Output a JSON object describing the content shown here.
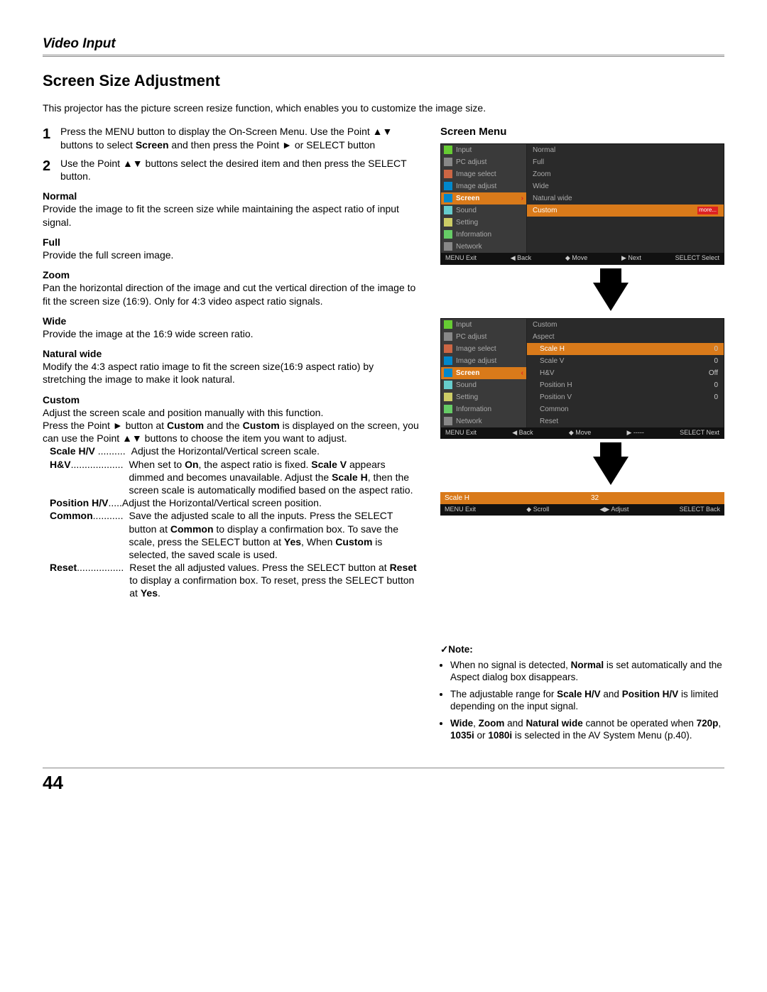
{
  "section": "Video Input",
  "title": "Screen Size Adjustment",
  "intro": "This projector has the picture screen resize function, which enables you to customize the image size.",
  "steps": {
    "s1": {
      "num": "1",
      "text_a": "Press the MENU button to display the On-Screen Menu. Use the Point ▲▼ buttons to select ",
      "bold": "Screen",
      "text_b": " and then press the Point ► or SELECT button"
    },
    "s2": {
      "num": "2",
      "text": "Use the Point ▲▼ buttons select the desired item and then press the SELECT button."
    }
  },
  "modes": {
    "normal": {
      "title": "Normal",
      "text": "Provide the image to fit the screen size while maintaining the aspect ratio of input signal."
    },
    "full": {
      "title": "Full",
      "text": "Provide the full screen image."
    },
    "zoom": {
      "title": "Zoom",
      "text": "Pan the horizontal direction of the image and cut the vertical direction of the image to fit the screen size (16:9). Only for 4:3 video aspect ratio signals."
    },
    "wide": {
      "title": "Wide",
      "text": "Provide the image at the 16:9 wide screen ratio."
    },
    "natural": {
      "title": "Natural wide",
      "text": "Modify the 4:3 aspect ratio image to fit the screen size(16:9 aspect ratio) by stretching the image to make it look natural."
    },
    "custom": {
      "title": "Custom",
      "p1": "Adjust the screen scale and position manually with this function.",
      "p2_a": "Press the Point ► button at ",
      "p2_b": "Custom",
      "p2_c": " and the ",
      "p2_d": "Custom",
      "p2_e": " is displayed on the screen, you can use the Point ▲▼ buttons to choose the item you want to adjust."
    }
  },
  "defs": {
    "scalehv": {
      "term": "Scale H/V",
      "dots": " ..........",
      "desc": "Adjust the Horizontal/Vertical screen scale."
    },
    "hv": {
      "term": "H&V",
      "dots": "...................",
      "desc_a": "When set to ",
      "on": "On",
      "desc_b": ", the aspect ratio is fixed. ",
      "sv": "Scale V",
      "desc_c": " appears dimmed and becomes unavailable. Adjust the ",
      "sh": "Scale H",
      "desc_d": ", then the screen scale is automatically modified based on the aspect ratio."
    },
    "poshv": {
      "term": "Position H/V",
      "dots": ".....",
      "desc": "Adjust the Horizontal/Vertical screen position."
    },
    "common": {
      "term": "Common",
      "dots": "...........",
      "desc_a": "Save the adjusted scale to all the inputs. Press the SELECT button at ",
      "cm": "Common",
      "desc_b": " to display a confirmation box. To save the scale, press the SELECT button at ",
      "yes": "Yes",
      "desc_c": ", When ",
      "cu": "Custom",
      "desc_d": " is selected, the saved scale is used."
    },
    "reset": {
      "term": "Reset",
      "dots": ".................",
      "desc_a": "Reset the all adjusted values. Press the SELECT button at ",
      "rs": "Reset",
      "desc_b": " to display a confirmation box. To reset, press the SELECT button at ",
      "yes": "Yes",
      "desc_c": "."
    }
  },
  "right_title": "Screen Menu",
  "osd1": {
    "left": [
      "Input",
      "PC adjust",
      "Image select",
      "Image adjust",
      "Screen",
      "Sound",
      "Setting",
      "Information",
      "Network"
    ],
    "right": [
      "Normal",
      "Full",
      "Zoom",
      "Wide",
      "Natural wide",
      "Custom"
    ],
    "more": "more...",
    "footer": [
      "MENU Exit",
      "◀ Back",
      "◆ Move",
      "▶ Next",
      "SELECT Select"
    ]
  },
  "osd2": {
    "left": [
      "Input",
      "PC adjust",
      "Image select",
      "Image adjust",
      "Screen",
      "Sound",
      "Setting",
      "Information",
      "Network"
    ],
    "right_top": [
      "Custom",
      "Aspect"
    ],
    "right_items": [
      {
        "label": "Scale H",
        "val": "0",
        "hl": true
      },
      {
        "label": "Scale V",
        "val": "0"
      },
      {
        "label": "H&V",
        "val": "Off"
      },
      {
        "label": "Position H",
        "val": "0"
      },
      {
        "label": "Position V",
        "val": "0"
      },
      {
        "label": "Common",
        "val": ""
      },
      {
        "label": "Reset",
        "val": ""
      }
    ],
    "footer": [
      "MENU Exit",
      "◀ Back",
      "◆ Move",
      "▶ -----",
      "SELECT Next"
    ]
  },
  "osd3": {
    "title": "Scale H",
    "val": "32",
    "footer": [
      "MENU Exit",
      "◆ Scroll",
      "◀▶ Adjust",
      "SELECT Back"
    ]
  },
  "note": {
    "title": "✓Note:",
    "items": {
      "n1_a": "When no signal is detected, ",
      "n1_b": "Normal",
      "n1_c": " is set automatically and the Aspect dialog box disappears.",
      "n2_a": "The adjustable range for ",
      "n2_b": "Scale H/V",
      "n2_c": " and ",
      "n2_d": "Position H/V",
      "n2_e": " is limited depending on the input signal.",
      "n3_a": "Wide",
      "n3_b": ", ",
      "n3_c": "Zoom",
      "n3_d": " and ",
      "n3_e": "Natural wide",
      "n3_f": " cannot be operated when ",
      "n3_g": "720p",
      "n3_h": ", ",
      "n3_i": "1035i",
      "n3_j": " or ",
      "n3_k": "1080i",
      "n3_l": " is selected in the AV System Menu (p.40)."
    }
  },
  "page": "44"
}
